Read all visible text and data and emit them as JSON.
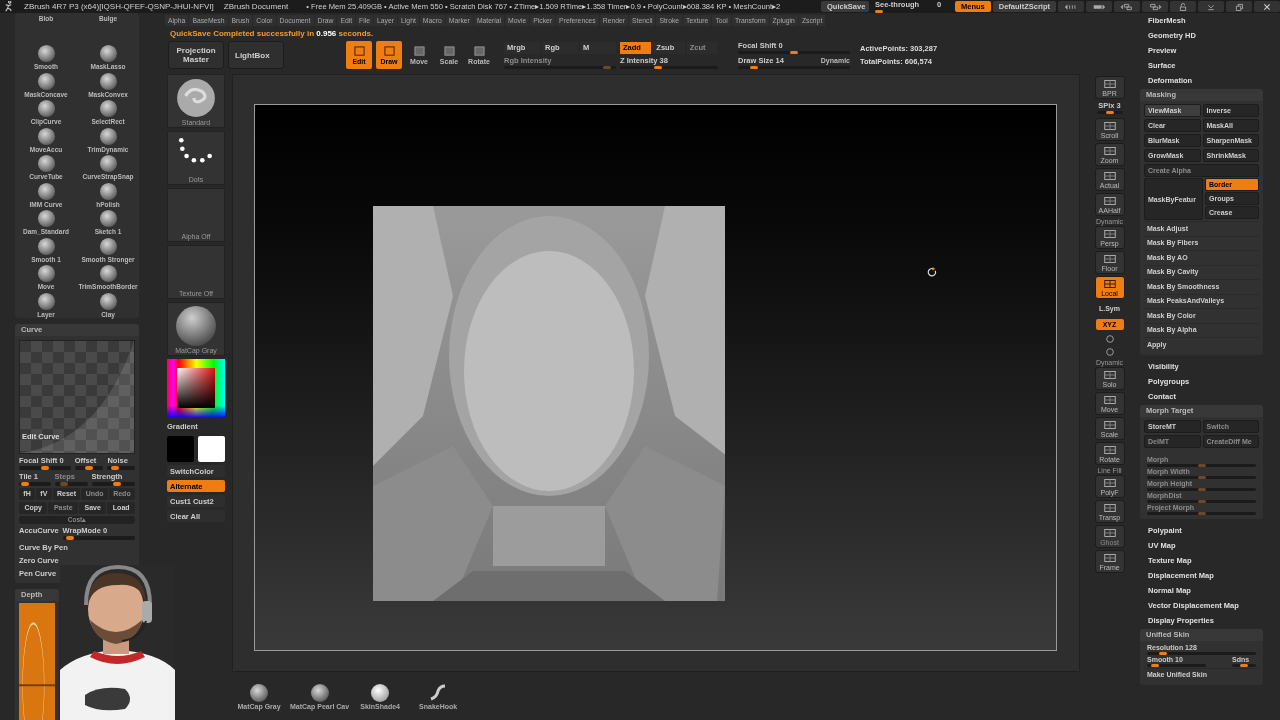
{
  "title_bar": {
    "app": "ZBrush 4R7 P3 (x64)[IQSH-QFEF-QSNP-JHUI-NFVI]",
    "document": "ZBrush Document",
    "stats": "• Free Mem 25.409GB • Active Mem 550 • Scratch Disk 767 • ZTime▸1.509 RTime▸1.358 Timer▸0.9 • PolyCount▸608.384 KP • MeshCount▸2"
  },
  "title_controls": {
    "quicksave": "QuickSave",
    "see_through": {
      "label": "See-through",
      "value": "0",
      "level": 0
    },
    "menus": {
      "label": "Menus",
      "selected": true
    },
    "script": "DefaultZScript"
  },
  "menu_bar": [
    "Alpha",
    "BaseMesh",
    "Brush",
    "Color",
    "Document",
    "Draw",
    "Edit",
    "File",
    "Layer",
    "Light",
    "Macro",
    "Marker",
    "Material",
    "Movie",
    "Picker",
    "Preferences",
    "Render",
    "Stencil",
    "Stroke",
    "Texture",
    "Tool",
    "Transform",
    "Zplugin",
    "Zscript"
  ],
  "notice": {
    "text": "QuickSave Completed successfully in",
    "time": "0.956",
    "suffix": "seconds."
  },
  "top_shelf": {
    "projection": "Projection Master",
    "lightbox": "LightBox",
    "modes": [
      {
        "label": "Edit",
        "selected": true
      },
      {
        "label": "Draw",
        "selected": true
      },
      {
        "label": "Move",
        "selected": false
      },
      {
        "label": "Scale",
        "selected": false
      },
      {
        "label": "Rotate",
        "selected": false
      }
    ],
    "channels": [
      {
        "label": "Mrgb",
        "selected": false
      },
      {
        "label": "Rgb",
        "selected": false
      },
      {
        "label": "M",
        "selected": false
      }
    ],
    "z_modes": [
      {
        "label": "Zadd",
        "selected": true,
        "disabled": false
      },
      {
        "label": "Zsub",
        "selected": false,
        "disabled": false
      },
      {
        "label": "Zcut",
        "selected": false,
        "disabled": true
      }
    ],
    "rgb_intensity": {
      "label": "Rgb Intensity",
      "level": 0.95,
      "disabled": true
    },
    "z_intensity": {
      "label": "Z Intensity 38",
      "level": 0.38,
      "disabled": false
    },
    "focal_shift": {
      "label": "Focal Shift 0",
      "level": 0.5
    },
    "draw_size": {
      "label": "Draw Size 14",
      "level": 0.12
    },
    "dynamic": "Dynamic",
    "active_points": "ActivePoints: 303,287",
    "total_points": "TotalPoints: 606,574"
  },
  "left_tray": {
    "brushes": [
      {
        "name": "Blob",
        "icon": false
      },
      {
        "name": "Bulge",
        "icon": false
      },
      {
        "name": "Smooth",
        "icon": true
      },
      {
        "name": "MaskLasso",
        "icon": true
      },
      {
        "name": "MaskConcave",
        "icon": true
      },
      {
        "name": "MaskConvex",
        "icon": true
      },
      {
        "name": "ClipCurve",
        "icon": true
      },
      {
        "name": "SelectRect",
        "icon": true
      },
      {
        "name": "MoveAccu",
        "icon": true
      },
      {
        "name": "TrimDynamic",
        "icon": true
      },
      {
        "name": "CurveTube",
        "icon": true
      },
      {
        "name": "CurveStrapSnap",
        "icon": true
      },
      {
        "name": "IMM Curve",
        "icon": true
      },
      {
        "name": "hPolish",
        "icon": true
      },
      {
        "name": "Dam_Standard",
        "icon": true
      },
      {
        "name": "Sketch 1",
        "icon": true
      },
      {
        "name": "Smooth 1",
        "icon": true
      },
      {
        "name": "Smooth Stronger",
        "icon": true
      },
      {
        "name": "Move",
        "icon": true
      },
      {
        "name": "TrimSmoothBorder",
        "icon": true
      },
      {
        "name": "Layer",
        "icon": true
      },
      {
        "name": "Clay",
        "icon": true
      }
    ],
    "curve": {
      "title": "Curve",
      "edit": "Edit Curve",
      "slider_rows": [
        [
          {
            "label": "Focal Shift 0",
            "level": 0.5,
            "disabled": false
          },
          {
            "label": "Offset",
            "level": 0.5,
            "disabled": false
          },
          {
            "label": "Noise",
            "level": 0.2,
            "disabled": false
          }
        ],
        [
          {
            "label": "Tile 1",
            "level": 0.1,
            "disabled": false
          },
          {
            "label": "Steps",
            "level": 0.2,
            "disabled": true
          },
          {
            "label": "Strength",
            "level": 0.6,
            "disabled": false
          }
        ]
      ],
      "button_rows": [
        [
          {
            "label": "fH",
            "disabled": false
          },
          {
            "label": "fV",
            "disabled": false
          },
          {
            "label": "Reset",
            "disabled": false
          },
          {
            "label": "Undo",
            "disabled": true
          },
          {
            "label": "Redo",
            "disabled": true
          }
        ],
        [
          {
            "label": "Copy",
            "disabled": false
          },
          {
            "label": "Paste",
            "disabled": true
          },
          {
            "label": "Save",
            "disabled": false
          },
          {
            "label": "Load",
            "disabled": false
          }
        ]
      ],
      "strip": "Cost▴",
      "accucurve": "AccuCurve",
      "wrapmode": {
        "label": "WrapMode 0",
        "level": 0.05
      },
      "options": [
        "Curve By Pen",
        "Zero Curve",
        "Pen Curve"
      ]
    },
    "depth": {
      "title": "Depth"
    }
  },
  "left_shelf": {
    "thumbs": [
      {
        "label": "Standard",
        "kind": "brush"
      },
      {
        "label": "Dots",
        "kind": "stroke"
      },
      {
        "label": "Alpha Off",
        "kind": "empty"
      },
      {
        "label": "Texture Off",
        "kind": "empty"
      },
      {
        "label": "MatCap Gray",
        "kind": "sphere"
      }
    ],
    "gradient": "Gradient",
    "swatches": [
      {
        "color": "#000000"
      },
      {
        "color": "#ffffff"
      }
    ],
    "buttons": [
      {
        "label": "SwitchColor",
        "on": false
      },
      {
        "label": "Alternate",
        "on": true
      },
      {
        "label": "Cust1 Cust2",
        "on": false
      },
      {
        "label": "Clear All",
        "on": false
      }
    ]
  },
  "right_shelf": [
    {
      "kind": "button",
      "label": "BPR",
      "on": false,
      "disabled": false
    },
    {
      "kind": "slider",
      "label": "SPix 3",
      "level": 0.5
    },
    {
      "kind": "button",
      "label": "Scroll",
      "on": false,
      "disabled": false
    },
    {
      "kind": "button",
      "label": "Zoom",
      "on": false,
      "disabled": false
    },
    {
      "kind": "button",
      "label": "Actual",
      "on": false,
      "disabled": false
    },
    {
      "kind": "button",
      "label": "AAHalf",
      "on": false,
      "disabled": false
    },
    {
      "kind": "button",
      "label": "Persp",
      "caption": "Dynamic",
      "on": false,
      "disabled": false
    },
    {
      "kind": "button",
      "label": "Floor",
      "on": false,
      "disabled": false
    },
    {
      "kind": "button",
      "label": "Local",
      "on": true,
      "disabled": false
    },
    {
      "kind": "toggle",
      "label": "L.Sym",
      "on": false
    },
    {
      "kind": "toggle",
      "label": "XYZ",
      "on": true
    },
    {
      "kind": "icon"
    },
    {
      "kind": "icon"
    },
    {
      "kind": "button",
      "label": "Solo",
      "caption": "Dynamic",
      "on": false,
      "disabled": false
    },
    {
      "kind": "button",
      "label": "Move",
      "on": false,
      "disabled": false
    },
    {
      "kind": "button",
      "label": "Scale",
      "on": false,
      "disabled": false
    },
    {
      "kind": "button",
      "label": "Rotate",
      "on": false,
      "disabled": false
    },
    {
      "kind": "button",
      "label": "PolyF",
      "caption": "Line Fill",
      "on": false,
      "disabled": false
    },
    {
      "kind": "button",
      "label": "Transp",
      "on": false,
      "disabled": false
    },
    {
      "kind": "button",
      "label": "Ghost",
      "on": false,
      "disabled": true
    },
    {
      "kind": "button",
      "label": "Frame",
      "on": false,
      "disabled": false
    }
  ],
  "right_tray": {
    "top_sections": [
      "FiberMesh",
      "Geometry HD",
      "Preview",
      "Surface",
      "Deformation"
    ],
    "masking": {
      "title": "Masking",
      "buttons": [
        {
          "label": "ViewMask",
          "on": true
        },
        {
          "label": "Inverse",
          "on": false
        },
        {
          "label": "Clear",
          "on": false
        },
        {
          "label": "MaskAll",
          "on": false
        },
        {
          "label": "BlurMask",
          "on": false
        },
        {
          "label": "SharpenMask",
          "on": false
        },
        {
          "label": "GrowMask",
          "on": false
        },
        {
          "label": "ShrinkMask",
          "on": false
        }
      ],
      "create_alpha": {
        "label": "Create Alpha",
        "disabled": true
      },
      "feature": "MaskByFeatur",
      "feature_options": [
        {
          "label": "Border",
          "selected": true
        },
        {
          "label": "Groups",
          "selected": false
        },
        {
          "label": "Crease",
          "selected": false
        }
      ],
      "items": [
        "Mask Adjust",
        "Mask By Fibers",
        "Mask By AO",
        "Mask By Cavity",
        "Mask By Smoothness",
        "Mask PeaksAndValleys",
        "Mask By Color",
        "Mask By Alpha",
        "Apply"
      ]
    },
    "mid_sections": [
      "Visibility",
      "Polygroups",
      "Contact"
    ],
    "morph": {
      "title": "Morph Target",
      "buttons": [
        {
          "label": "StoreMT",
          "disabled": false
        },
        {
          "label": "Switch",
          "disabled": true
        },
        {
          "label": "DelMT",
          "disabled": true
        },
        {
          "label": "CreateDiff Me",
          "disabled": true
        }
      ],
      "sliders": [
        {
          "label": "Morph",
          "level": 0.5,
          "disabled": true
        },
        {
          "label": "Morph Width",
          "level": 0.5,
          "disabled": true
        },
        {
          "label": "Morph Height",
          "level": 0.5,
          "disabled": true
        },
        {
          "label": "MorphDist",
          "level": 0.5,
          "disabled": true
        },
        {
          "label": "Project Morph",
          "level": 0.5,
          "disabled": true
        }
      ]
    },
    "bottom_sections": [
      "Polypaint",
      "UV Map",
      "Texture Map",
      "Displacement Map",
      "Normal Map",
      "Vector Displacement Map",
      "Display Properties"
    ],
    "unified": {
      "title": "Unified Skin",
      "resolution": {
        "label": "Resolution 128",
        "level": 0.12
      },
      "smooth": {
        "label": "Smooth 10",
        "level": 0.08
      },
      "sdns": {
        "label": "Sdns",
        "level": 0.5
      },
      "make": "Make Unified Skin"
    }
  },
  "bottom_shelf": [
    {
      "label": "MatCap Gray",
      "kind": "sphere"
    },
    {
      "label": "MatCap Pearl Cav",
      "kind": "sphere"
    },
    {
      "label": "SkinShade4",
      "kind": "bright"
    },
    {
      "label": "SnakeHook",
      "kind": "hook"
    }
  ]
}
